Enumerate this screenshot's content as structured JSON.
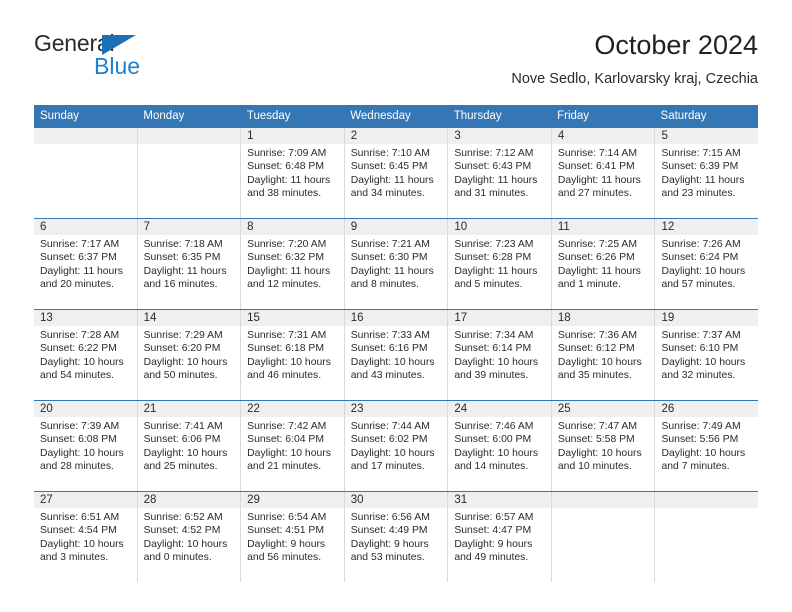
{
  "brand": {
    "word_one": "General",
    "word_two": "Blue",
    "logo_icon": "triangle-logo-icon",
    "accent_color": "#1f7fd0"
  },
  "header": {
    "title": "October 2024",
    "subtitle": "Nove Sedlo, Karlovarsky kraj, Czechia"
  },
  "colors": {
    "header_band": "#3576b5",
    "daynum_band": "#efefef",
    "row_divider": "#3576b5",
    "cell_divider": "#d9d9d9",
    "text": "#2b2b2b"
  },
  "weekdays": [
    "Sunday",
    "Monday",
    "Tuesday",
    "Wednesday",
    "Thursday",
    "Friday",
    "Saturday"
  ],
  "weeks": [
    [
      {
        "day": "",
        "empty": true
      },
      {
        "day": "",
        "empty": true
      },
      {
        "day": "1",
        "sunrise": "Sunrise: 7:09 AM",
        "sunset": "Sunset: 6:48 PM",
        "daylight_line1": "Daylight: 11 hours",
        "daylight_line2": "and 38 minutes."
      },
      {
        "day": "2",
        "sunrise": "Sunrise: 7:10 AM",
        "sunset": "Sunset: 6:45 PM",
        "daylight_line1": "Daylight: 11 hours",
        "daylight_line2": "and 34 minutes."
      },
      {
        "day": "3",
        "sunrise": "Sunrise: 7:12 AM",
        "sunset": "Sunset: 6:43 PM",
        "daylight_line1": "Daylight: 11 hours",
        "daylight_line2": "and 31 minutes."
      },
      {
        "day": "4",
        "sunrise": "Sunrise: 7:14 AM",
        "sunset": "Sunset: 6:41 PM",
        "daylight_line1": "Daylight: 11 hours",
        "daylight_line2": "and 27 minutes."
      },
      {
        "day": "5",
        "sunrise": "Sunrise: 7:15 AM",
        "sunset": "Sunset: 6:39 PM",
        "daylight_line1": "Daylight: 11 hours",
        "daylight_line2": "and 23 minutes."
      }
    ],
    [
      {
        "day": "6",
        "sunrise": "Sunrise: 7:17 AM",
        "sunset": "Sunset: 6:37 PM",
        "daylight_line1": "Daylight: 11 hours",
        "daylight_line2": "and 20 minutes."
      },
      {
        "day": "7",
        "sunrise": "Sunrise: 7:18 AM",
        "sunset": "Sunset: 6:35 PM",
        "daylight_line1": "Daylight: 11 hours",
        "daylight_line2": "and 16 minutes."
      },
      {
        "day": "8",
        "sunrise": "Sunrise: 7:20 AM",
        "sunset": "Sunset: 6:32 PM",
        "daylight_line1": "Daylight: 11 hours",
        "daylight_line2": "and 12 minutes."
      },
      {
        "day": "9",
        "sunrise": "Sunrise: 7:21 AM",
        "sunset": "Sunset: 6:30 PM",
        "daylight_line1": "Daylight: 11 hours",
        "daylight_line2": "and 8 minutes."
      },
      {
        "day": "10",
        "sunrise": "Sunrise: 7:23 AM",
        "sunset": "Sunset: 6:28 PM",
        "daylight_line1": "Daylight: 11 hours",
        "daylight_line2": "and 5 minutes."
      },
      {
        "day": "11",
        "sunrise": "Sunrise: 7:25 AM",
        "sunset": "Sunset: 6:26 PM",
        "daylight_line1": "Daylight: 11 hours",
        "daylight_line2": "and 1 minute."
      },
      {
        "day": "12",
        "sunrise": "Sunrise: 7:26 AM",
        "sunset": "Sunset: 6:24 PM",
        "daylight_line1": "Daylight: 10 hours",
        "daylight_line2": "and 57 minutes."
      }
    ],
    [
      {
        "day": "13",
        "sunrise": "Sunrise: 7:28 AM",
        "sunset": "Sunset: 6:22 PM",
        "daylight_line1": "Daylight: 10 hours",
        "daylight_line2": "and 54 minutes."
      },
      {
        "day": "14",
        "sunrise": "Sunrise: 7:29 AM",
        "sunset": "Sunset: 6:20 PM",
        "daylight_line1": "Daylight: 10 hours",
        "daylight_line2": "and 50 minutes."
      },
      {
        "day": "15",
        "sunrise": "Sunrise: 7:31 AM",
        "sunset": "Sunset: 6:18 PM",
        "daylight_line1": "Daylight: 10 hours",
        "daylight_line2": "and 46 minutes."
      },
      {
        "day": "16",
        "sunrise": "Sunrise: 7:33 AM",
        "sunset": "Sunset: 6:16 PM",
        "daylight_line1": "Daylight: 10 hours",
        "daylight_line2": "and 43 minutes."
      },
      {
        "day": "17",
        "sunrise": "Sunrise: 7:34 AM",
        "sunset": "Sunset: 6:14 PM",
        "daylight_line1": "Daylight: 10 hours",
        "daylight_line2": "and 39 minutes."
      },
      {
        "day": "18",
        "sunrise": "Sunrise: 7:36 AM",
        "sunset": "Sunset: 6:12 PM",
        "daylight_line1": "Daylight: 10 hours",
        "daylight_line2": "and 35 minutes."
      },
      {
        "day": "19",
        "sunrise": "Sunrise: 7:37 AM",
        "sunset": "Sunset: 6:10 PM",
        "daylight_line1": "Daylight: 10 hours",
        "daylight_line2": "and 32 minutes."
      }
    ],
    [
      {
        "day": "20",
        "sunrise": "Sunrise: 7:39 AM",
        "sunset": "Sunset: 6:08 PM",
        "daylight_line1": "Daylight: 10 hours",
        "daylight_line2": "and 28 minutes."
      },
      {
        "day": "21",
        "sunrise": "Sunrise: 7:41 AM",
        "sunset": "Sunset: 6:06 PM",
        "daylight_line1": "Daylight: 10 hours",
        "daylight_line2": "and 25 minutes."
      },
      {
        "day": "22",
        "sunrise": "Sunrise: 7:42 AM",
        "sunset": "Sunset: 6:04 PM",
        "daylight_line1": "Daylight: 10 hours",
        "daylight_line2": "and 21 minutes."
      },
      {
        "day": "23",
        "sunrise": "Sunrise: 7:44 AM",
        "sunset": "Sunset: 6:02 PM",
        "daylight_line1": "Daylight: 10 hours",
        "daylight_line2": "and 17 minutes."
      },
      {
        "day": "24",
        "sunrise": "Sunrise: 7:46 AM",
        "sunset": "Sunset: 6:00 PM",
        "daylight_line1": "Daylight: 10 hours",
        "daylight_line2": "and 14 minutes."
      },
      {
        "day": "25",
        "sunrise": "Sunrise: 7:47 AM",
        "sunset": "Sunset: 5:58 PM",
        "daylight_line1": "Daylight: 10 hours",
        "daylight_line2": "and 10 minutes."
      },
      {
        "day": "26",
        "sunrise": "Sunrise: 7:49 AM",
        "sunset": "Sunset: 5:56 PM",
        "daylight_line1": "Daylight: 10 hours",
        "daylight_line2": "and 7 minutes."
      }
    ],
    [
      {
        "day": "27",
        "sunrise": "Sunrise: 6:51 AM",
        "sunset": "Sunset: 4:54 PM",
        "daylight_line1": "Daylight: 10 hours",
        "daylight_line2": "and 3 minutes."
      },
      {
        "day": "28",
        "sunrise": "Sunrise: 6:52 AM",
        "sunset": "Sunset: 4:52 PM",
        "daylight_line1": "Daylight: 10 hours",
        "daylight_line2": "and 0 minutes."
      },
      {
        "day": "29",
        "sunrise": "Sunrise: 6:54 AM",
        "sunset": "Sunset: 4:51 PM",
        "daylight_line1": "Daylight: 9 hours",
        "daylight_line2": "and 56 minutes."
      },
      {
        "day": "30",
        "sunrise": "Sunrise: 6:56 AM",
        "sunset": "Sunset: 4:49 PM",
        "daylight_line1": "Daylight: 9 hours",
        "daylight_line2": "and 53 minutes."
      },
      {
        "day": "31",
        "sunrise": "Sunrise: 6:57 AM",
        "sunset": "Sunset: 4:47 PM",
        "daylight_line1": "Daylight: 9 hours",
        "daylight_line2": "and 49 minutes."
      },
      {
        "day": "",
        "empty": true
      },
      {
        "day": "",
        "empty": true
      }
    ]
  ]
}
